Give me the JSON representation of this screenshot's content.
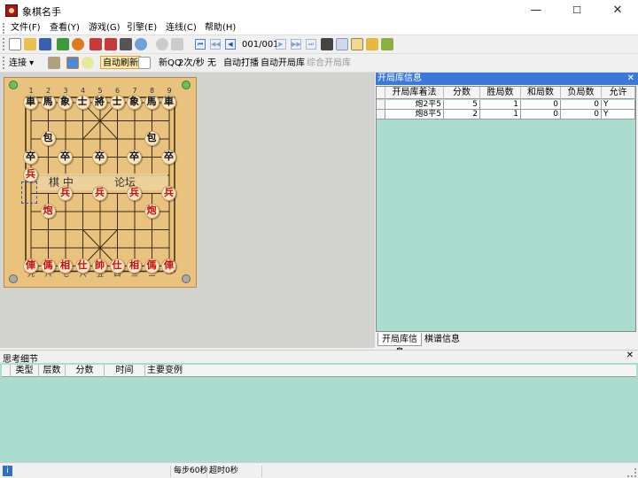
{
  "window": {
    "title": "象棋名手",
    "minimize": "—",
    "maximize": "☐",
    "close": "✕"
  },
  "menu": [
    "文件(F)",
    "查看(Y)",
    "游戏(G)",
    "引擎(E)",
    "连线(C)",
    "帮助(H)"
  ],
  "toolbar1": {
    "move_counter": "001/001"
  },
  "toolbar2": {
    "connect": "连接",
    "auto_refresh": "自动刷新",
    "qq_new": "新QQ",
    "rate": "2次/秒",
    "none": "无",
    "auto_play": "自动打播",
    "auto_opening": "自动开局库",
    "combined_opening": "综合开局库"
  },
  "board": {
    "files_top": [
      "1",
      "2",
      "3",
      "4",
      "5",
      "6",
      "7",
      "8",
      "9"
    ],
    "files_bottom": [
      "九",
      "八",
      "七",
      "六",
      "五",
      "四",
      "三",
      "二",
      "一"
    ],
    "river_left": "棋 中",
    "river_right": "论坛",
    "black_pieces": [
      {
        "ch": "車",
        "c": 0,
        "r": 0
      },
      {
        "ch": "馬",
        "c": 1,
        "r": 0
      },
      {
        "ch": "象",
        "c": 2,
        "r": 0
      },
      {
        "ch": "士",
        "c": 3,
        "r": 0
      },
      {
        "ch": "將",
        "c": 4,
        "r": 0
      },
      {
        "ch": "士",
        "c": 5,
        "r": 0
      },
      {
        "ch": "象",
        "c": 6,
        "r": 0
      },
      {
        "ch": "馬",
        "c": 7,
        "r": 0
      },
      {
        "ch": "車",
        "c": 8,
        "r": 0
      },
      {
        "ch": "包",
        "c": 1,
        "r": 2
      },
      {
        "ch": "包",
        "c": 7,
        "r": 2
      },
      {
        "ch": "卒",
        "c": 0,
        "r": 3
      },
      {
        "ch": "卒",
        "c": 2,
        "r": 3
      },
      {
        "ch": "卒",
        "c": 4,
        "r": 3
      },
      {
        "ch": "卒",
        "c": 6,
        "r": 3
      },
      {
        "ch": "卒",
        "c": 8,
        "r": 3
      }
    ],
    "red_pieces": [
      {
        "ch": "兵",
        "c": 0,
        "r": 4
      },
      {
        "ch": "兵",
        "c": 2,
        "r": 5
      },
      {
        "ch": "兵",
        "c": 4,
        "r": 5
      },
      {
        "ch": "兵",
        "c": 6,
        "r": 5
      },
      {
        "ch": "兵",
        "c": 8,
        "r": 5
      },
      {
        "ch": "炮",
        "c": 1,
        "r": 6
      },
      {
        "ch": "炮",
        "c": 7,
        "r": 6
      },
      {
        "ch": "俥",
        "c": 0,
        "r": 9
      },
      {
        "ch": "傌",
        "c": 1,
        "r": 9
      },
      {
        "ch": "相",
        "c": 2,
        "r": 9
      },
      {
        "ch": "仕",
        "c": 3,
        "r": 9
      },
      {
        "ch": "帥",
        "c": 4,
        "r": 9
      },
      {
        "ch": "仕",
        "c": 5,
        "r": 9
      },
      {
        "ch": "相",
        "c": 6,
        "r": 9
      },
      {
        "ch": "傌",
        "c": 7,
        "r": 9
      },
      {
        "ch": "俥",
        "c": 8,
        "r": 9
      }
    ]
  },
  "opening_panel": {
    "title": "开局库信息",
    "columns": [
      "开局库着法",
      "分数",
      "胜局数",
      "和局数",
      "负局数",
      "允许"
    ],
    "rows": [
      [
        "炮2平5",
        "5",
        "1",
        "0",
        "0",
        "Y"
      ],
      [
        "炮8平5",
        "2",
        "1",
        "0",
        "0",
        "Y"
      ]
    ],
    "tabs": [
      "开局库信息",
      "棋谱信息"
    ]
  },
  "thinking_panel": {
    "title": "思考细节",
    "columns": [
      "类型",
      "层数",
      "分数",
      "时间",
      "主要变例"
    ]
  },
  "status": {
    "per_step": "每步60秒",
    "timeout": "超时0秒"
  },
  "colors": {
    "panel_header": "#3b78d8",
    "grid_bg": "#aadcd0",
    "board": "#e9c27d",
    "red_piece": "#c41010"
  }
}
